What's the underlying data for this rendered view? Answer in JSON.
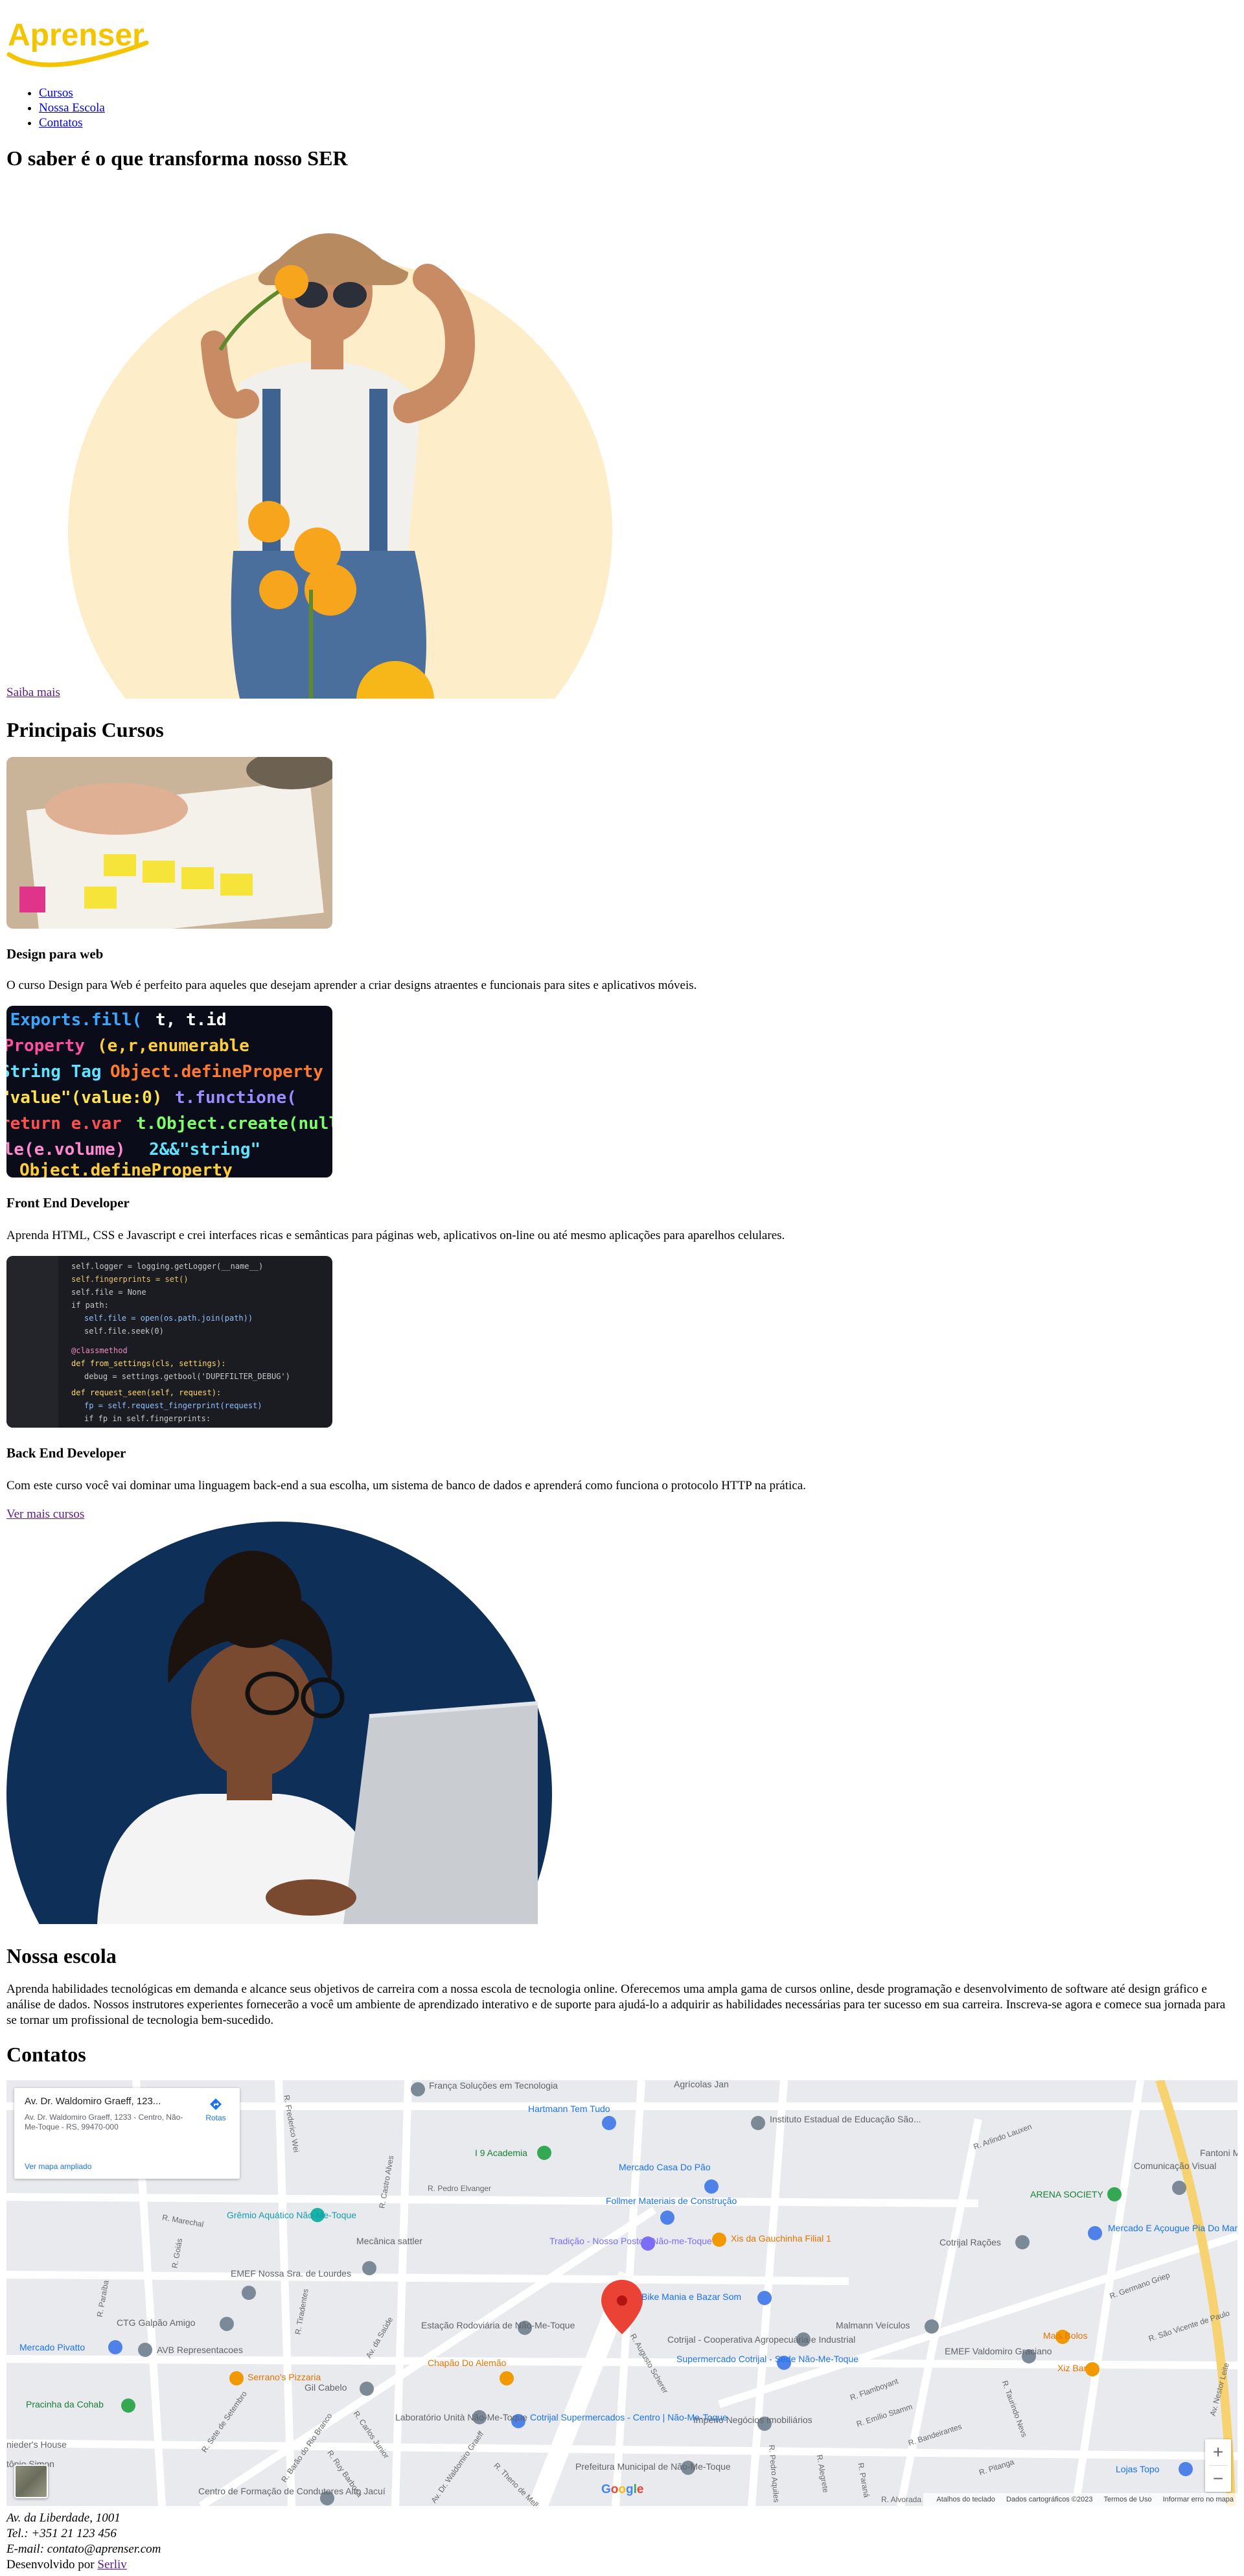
{
  "brand": {
    "logo_text": "Aprenser",
    "color": "#f5c400"
  },
  "nav": {
    "items": [
      "Cursos",
      "Nossa Escola",
      "Contatos"
    ]
  },
  "hero": {
    "title": "O saber é o que transforma nosso SER",
    "link": "Saiba mais"
  },
  "courses": {
    "title": "Principais Cursos",
    "items": [
      {
        "name": "Design para web",
        "desc": "O curso Design para Web é perfeito para aqueles que desejam aprender a criar designs atraentes e funcionais para sites e aplicativos móveis."
      },
      {
        "name": "Front End Developer",
        "desc": "Aprenda HTML, CSS e Javascript e crei interfaces ricas e semânticas para páginas web, aplicativos on-line ou até mesmo aplicações para aparelhos celulares."
      },
      {
        "name": "Back End Developer",
        "desc": "Com este curso você vai dominar uma linguagem back-end a sua escolha, um sistema de banco de dados e aprenderá como funciona o protocolo HTTP na prática."
      }
    ],
    "more_link": "Ver mais cursos"
  },
  "school": {
    "title": "Nossa escola",
    "text": "Aprenda habilidades tecnológicas em demanda e alcance seus objetivos de carreira com a nossa escola de tecnologia online. Oferecemos uma ampla gama de cursos online, desde programação e desenvolvimento de software até design gráfico e análise de dados. Nossos instrutores experientes fornecerão a você um ambiente de aprendizado interativo e de suporte para ajudá-lo a adquirir as habilidades necessárias para ter sucesso em sua carreira. Inscreva-se agora e comece sua jornada para se tornar um profissional de tecnologia bem-sucedido."
  },
  "contacts": {
    "title": "Contatos",
    "map": {
      "place_title": "Av. Dr. Waldomiro Graeff, 123...",
      "place_address": "Av. Dr. Waldomiro Graeff, 1233 - Centro, Não-Me-Toque - RS, 99470-000",
      "route_label": "Rotas",
      "view_larger": "Ver mapa ampliado",
      "google": "Google",
      "footer": [
        "Atalhos do teclado",
        "Dados cartográficos ©2023",
        "Termos de Uso",
        "Informar erro no mapa"
      ],
      "zoom_in": "+",
      "zoom_out": "−",
      "places": [
        "Agrícolas Jan",
        "França Soluções em Tecnologia",
        "Hartmann Tem Tudo",
        "Instituto Estadual de Educação São...",
        "I 9 Academia",
        "Mercado Casa Do Pão",
        "Comunicação Visual",
        "Fantoni Motormec",
        "ARENA SOCIETY",
        "Follmer Materiais de Construção",
        "Grêmio Aquático Não-Me-Toque",
        "Tradição - Nosso Posto - Não-me-Toque",
        "Xis da Gauchinha Filial 1",
        "Cotrijal Rações",
        "Mercado E Açougue Pia Do Mano",
        "Mecânica sattler",
        "EMEF Nossa Sra. de Lourdes",
        "Bike Mania e Bazar Som",
        "CTG Galpão Amigo",
        "Estação Rodoviária de Não-Me-Toque",
        "Malmann Veículos",
        "Cotrijal - Cooperativa Agropecuária e Industrial",
        "Mais Bolos",
        "Mercado Pivatto",
        "AVB Representacoes",
        "EMEF Valdomiro Graciano",
        "Supermercado Cotrijal - Sede Não-Me-Toque",
        "Xiz Bar",
        "Chapão Do Alemão",
        "Serrano's Pizzaria",
        "Gil Cabelo",
        "Pracinha da Cohab",
        "Laboratório Unità Não-Me-Toque",
        "Cotrijal Supermercados - Centro | Não-Me-Toque",
        "Império Negócios Imobiliários",
        "Lojas Topo",
        "nieder's House",
        "tônio Simon",
        "Prefeitura Municipal de Não-Me-Toque",
        "Centro de Formação de Condutores Alto Jacuí"
      ],
      "streets": [
        "R. Frederico Wei",
        "R. Castro Alves",
        "R. Pedro Elvanger",
        "R. Marechal",
        "R. Goiás",
        "R. Paraíba",
        "R. Arlindo Lauxen",
        "R. Germano Griep",
        "R. São Vicente de Paulo",
        "R. Flamboyant",
        "R. Emílio Stamm",
        "R. Bandeirantes",
        "R. Pitanga",
        "R. Taurindo Nevs",
        "R. Augusto Scherer",
        "R. Pedro Aquiles",
        "R. Alegrete",
        "R. Paraná",
        "Av. Dr. Waldomiro Graeff",
        "R. Sete de Setembro",
        "R. Barão do Rio Branco",
        "R. Ruy Barbosa",
        "R. Carlos Junior",
        "Av. da Saúde",
        "R. Tiradentes",
        "R. Theno de Mello",
        "R. Alvorada",
        "Av. Nestor Leite"
      ]
    }
  },
  "footer": {
    "address": "Av. da Liberdade, 1001",
    "phone": "Tel.: +351 21 123 456",
    "email": "E-mail: contato@aprenser.com",
    "dev_prefix": "Desenvolvido por",
    "dev_link": "Serliv"
  }
}
